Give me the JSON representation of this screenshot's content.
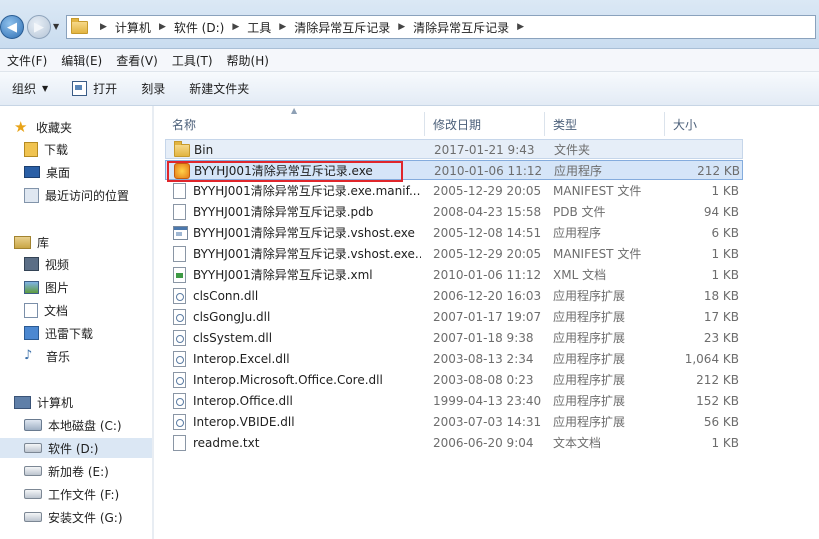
{
  "address_bar": {
    "crumbs": [
      "计算机",
      "软件 (D:)",
      "工具",
      "清除异常互斥记录",
      "清除异常互斥记录"
    ]
  },
  "menu": [
    "文件(F)",
    "编辑(E)",
    "查看(V)",
    "工具(T)",
    "帮助(H)"
  ],
  "toolbar": {
    "organize": "组织",
    "open": "打开",
    "burn": "刻录",
    "new_folder": "新建文件夹"
  },
  "nav": {
    "favorites": "收藏夹",
    "downloads": "下载",
    "desktop": "桌面",
    "recent": "最近访问的位置",
    "libraries": "库",
    "videos": "视频",
    "pictures": "图片",
    "documents": "文档",
    "thunder": "迅雷下载",
    "music": "音乐",
    "computer": "计算机",
    "drive_c": "本地磁盘 (C:)",
    "drive_d": "软件 (D:)",
    "drive_e": "新加卷 (E:)",
    "drive_f": "工作文件 (F:)",
    "drive_g": "安装文件 (G:)"
  },
  "columns": {
    "name": "名称",
    "modified": "修改日期",
    "type": "类型",
    "size": "大小"
  },
  "files": [
    {
      "name": "Bin",
      "modified": "2017-01-21 9:43",
      "type": "文件夹",
      "size": "",
      "icon": "folder-icon"
    },
    {
      "name": "BYYHJ001清除异常互斥记录.exe",
      "modified": "2010-01-06 11:12",
      "type": "应用程序",
      "size": "212 KB",
      "icon": "app-icon"
    },
    {
      "name": "BYYHJ001清除异常互斥记录.exe.manif...",
      "modified": "2005-12-29 20:05",
      "type": "MANIFEST 文件",
      "size": "1 KB",
      "icon": "document-icon"
    },
    {
      "name": "BYYHJ001清除异常互斥记录.pdb",
      "modified": "2008-04-23 15:58",
      "type": "PDB 文件",
      "size": "94 KB",
      "icon": "document-icon"
    },
    {
      "name": "BYYHJ001清除异常互斥记录.vshost.exe",
      "modified": "2005-12-08 14:51",
      "type": "应用程序",
      "size": "6 KB",
      "icon": "exe-icon"
    },
    {
      "name": "BYYHJ001清除异常互斥记录.vshost.exe....",
      "modified": "2005-12-29 20:05",
      "type": "MANIFEST 文件",
      "size": "1 KB",
      "icon": "document-icon"
    },
    {
      "name": "BYYHJ001清除异常互斥记录.xml",
      "modified": "2010-01-06 11:12",
      "type": "XML 文档",
      "size": "1 KB",
      "icon": "xml-icon"
    },
    {
      "name": "clsConn.dll",
      "modified": "2006-12-20 16:03",
      "type": "应用程序扩展",
      "size": "18 KB",
      "icon": "dll-icon"
    },
    {
      "name": "clsGongJu.dll",
      "modified": "2007-01-17 19:07",
      "type": "应用程序扩展",
      "size": "17 KB",
      "icon": "dll-icon"
    },
    {
      "name": "clsSystem.dll",
      "modified": "2007-01-18 9:38",
      "type": "应用程序扩展",
      "size": "23 KB",
      "icon": "dll-icon"
    },
    {
      "name": "Interop.Excel.dll",
      "modified": "2003-08-13 2:34",
      "type": "应用程序扩展",
      "size": "1,064 KB",
      "icon": "dll-icon"
    },
    {
      "name": "Interop.Microsoft.Office.Core.dll",
      "modified": "2003-08-08 0:23",
      "type": "应用程序扩展",
      "size": "212 KB",
      "icon": "dll-icon"
    },
    {
      "name": "Interop.Office.dll",
      "modified": "1999-04-13 23:40",
      "type": "应用程序扩展",
      "size": "152 KB",
      "icon": "dll-icon"
    },
    {
      "name": "Interop.VBIDE.dll",
      "modified": "2003-07-03 14:31",
      "type": "应用程序扩展",
      "size": "56 KB",
      "icon": "dll-icon"
    },
    {
      "name": "readme.txt",
      "modified": "2006-06-20 9:04",
      "type": "文本文档",
      "size": "1 KB",
      "icon": "document-icon"
    }
  ],
  "colors": {
    "selection_bg": "#d5e5f8",
    "highlight_border": "#e0262b"
  }
}
